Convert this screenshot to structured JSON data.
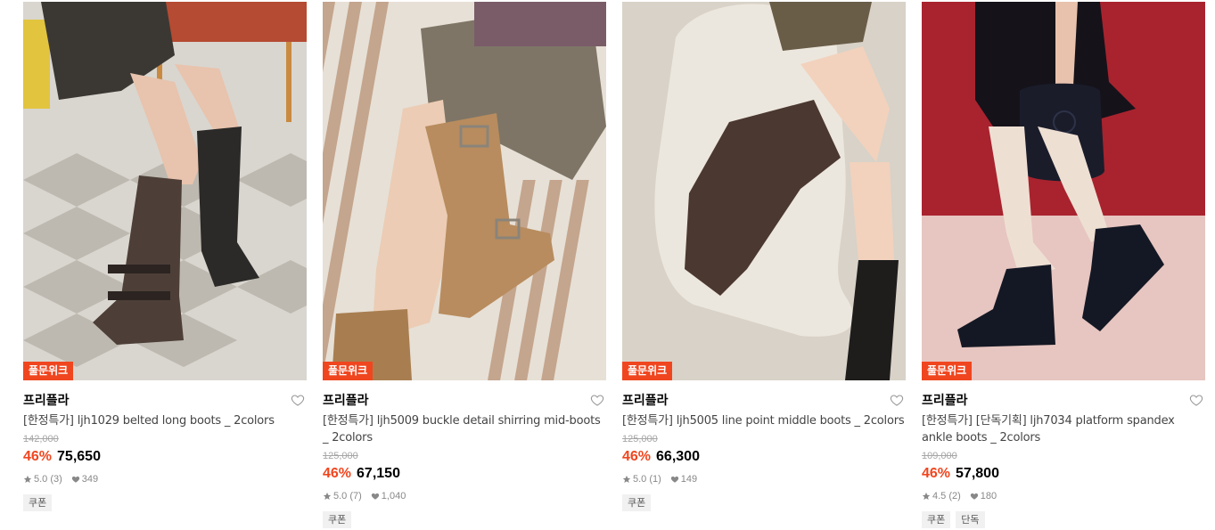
{
  "colors": {
    "accent": "#f0461f",
    "badge_bg": "#f0461f",
    "original_price": "#a6a6a6",
    "tag_bg": "#f1f1f1"
  },
  "products": [
    {
      "badge": "풀문위크",
      "brand": "프리플라",
      "title": "[한정특가] ljh1029 belted long boots _ 2colors",
      "original_price": "142,000",
      "discount": "46%",
      "price": "75,650",
      "rating": "5.0 (3)",
      "likes": "349",
      "tags": [
        "쿠폰"
      ],
      "image_icon": "boots-photo"
    },
    {
      "badge": "풀문위크",
      "brand": "프리플라",
      "title": "[한정특가] ljh5009 buckle detail shirring mid-boots _ 2colors",
      "original_price": "125,000",
      "discount": "46%",
      "price": "67,150",
      "rating": "5.0 (7)",
      "likes": "1,040",
      "tags": [
        "쿠폰"
      ],
      "image_icon": "boots-photo"
    },
    {
      "badge": "풀문위크",
      "brand": "프리플라",
      "title": "[한정특가] ljh5005 line point middle boots _ 2colors",
      "original_price": "125,000",
      "discount": "46%",
      "price": "66,300",
      "rating": "5.0 (1)",
      "likes": "149",
      "tags": [
        "쿠폰"
      ],
      "image_icon": "boots-photo"
    },
    {
      "badge": "풀문위크",
      "brand": "프리플라",
      "title": "[한정특가] [단독기획] ljh7034 platform spandex ankle boots _ 2colors",
      "original_price": "109,000",
      "discount": "46%",
      "price": "57,800",
      "rating": "4.5 (2)",
      "likes": "180",
      "tags": [
        "쿠폰",
        "단독"
      ],
      "image_icon": "boots-photo"
    }
  ]
}
